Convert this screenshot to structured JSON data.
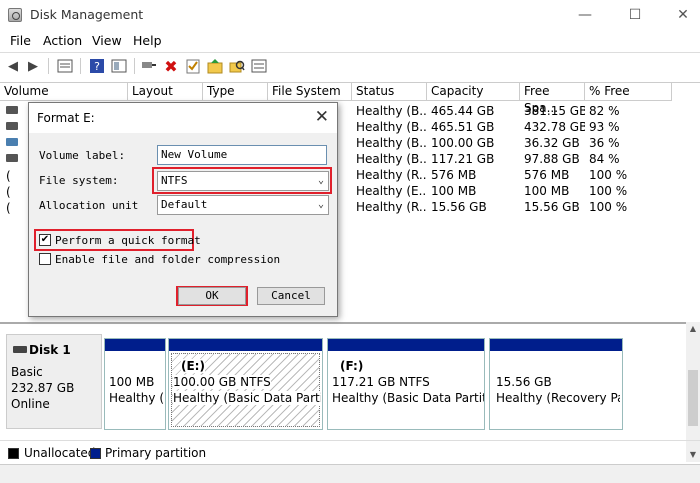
{
  "window": {
    "title": "Disk Management",
    "minimize": "—",
    "maximize": "☐",
    "close": "✕"
  },
  "menu": [
    "File",
    "Action",
    "View",
    "Help"
  ],
  "toolbar_icons": [
    "back-arrow-icon",
    "forward-arrow-icon",
    "properties-icon",
    "help-icon",
    "console-icon",
    "connect-icon",
    "delete-icon",
    "check-icon",
    "folder-icon",
    "search-folder-icon",
    "list-icon"
  ],
  "volumes": {
    "headers": [
      "Volume",
      "Layout",
      "Type",
      "File System",
      "Status",
      "Capacity",
      "Free Spa...",
      "% Free"
    ],
    "rows": [
      {
        "volume": "",
        "status": "Healthy (B...",
        "capacity": "465.44 GB",
        "free": "381.15 GB",
        "pct": "82 %"
      },
      {
        "volume": "",
        "status": "Healthy (B...",
        "capacity": "465.51 GB",
        "free": "432.78 GB",
        "pct": "93 %"
      },
      {
        "volume": "",
        "status": "Healthy (B...",
        "capacity": "100.00 GB",
        "free": "36.32 GB",
        "pct": "36 %"
      },
      {
        "volume": "",
        "status": "Healthy (B...",
        "capacity": "117.21 GB",
        "free": "97.88 GB",
        "pct": "84 %"
      },
      {
        "volume": "(",
        "status": "Healthy (R...",
        "capacity": "576 MB",
        "free": "576 MB",
        "pct": "100 %"
      },
      {
        "volume": "(",
        "status": "Healthy (E...",
        "capacity": "100 MB",
        "free": "100 MB",
        "pct": "100 %"
      },
      {
        "volume": "(",
        "status": "Healthy (R...",
        "capacity": "15.56 GB",
        "free": "15.56 GB",
        "pct": "100 %"
      }
    ]
  },
  "dialog": {
    "title": "Format E:",
    "close": "✕",
    "volume_label_text": "Volume label:",
    "volume_label_value": "New Volume",
    "file_system_text": "File system:",
    "file_system_value": "NTFS",
    "allocation_text": "Allocation unit",
    "allocation_value": "Default",
    "quick_format_text": "Perform a quick format",
    "quick_format_checked": "✔",
    "compression_text": "Enable file and folder compression",
    "ok": "OK",
    "cancel": "Cancel",
    "highlight_color": "#e0202c"
  },
  "disk": {
    "name": "Disk 1",
    "type": "Basic",
    "size": "232.87 GB",
    "status": "Online",
    "partitions": [
      {
        "label": "",
        "size": "100 MB",
        "status": "Healthy ("
      },
      {
        "label": "(E:)",
        "size": "100.00 GB NTFS",
        "status": "Healthy (Basic Data Partition"
      },
      {
        "label": "(F:)",
        "size": "117.21 GB NTFS",
        "status": "Healthy (Basic Data Partition"
      },
      {
        "label": "",
        "size": "15.56 GB",
        "status": "Healthy (Recovery Parti"
      }
    ]
  },
  "legend": [
    {
      "label": "Unallocated",
      "color": "#000000"
    },
    {
      "label": "Primary partition",
      "color": "#001e8c"
    }
  ],
  "partition_bar_color": "#001e8c"
}
